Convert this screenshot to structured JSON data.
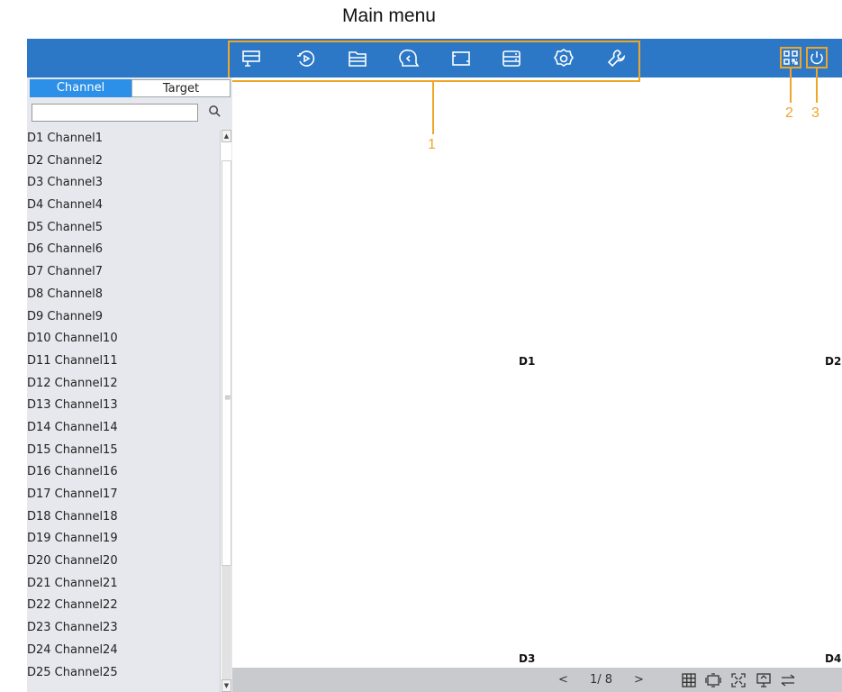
{
  "annotation": {
    "title": "Main menu",
    "callouts": [
      "1",
      "2",
      "3"
    ]
  },
  "toolbar": {
    "main_menu_icons": [
      "live-view-icon",
      "playback-icon",
      "file-icon",
      "ai-face-icon",
      "channel-camera-icon",
      "storage-icon",
      "settings-icon",
      "maintenance-icon"
    ],
    "right_icons": [
      "qr-code-icon",
      "power-icon"
    ],
    "accent": "#2c78c7",
    "highlight": "#f0a526"
  },
  "sidebar": {
    "tabs": [
      {
        "label": "Channel",
        "active": true
      },
      {
        "label": "Target",
        "active": false
      }
    ],
    "search": {
      "placeholder": "",
      "value": ""
    },
    "channels": [
      "D1 Channel1",
      "D2 Channel2",
      "D3 Channel3",
      "D4 Channel4",
      "D5 Channel5",
      "D6 Channel6",
      "D7 Channel7",
      "D8 Channel8",
      "D9 Channel9",
      "D10 Channel10",
      "D11 Channel11",
      "D12 Channel12",
      "D13 Channel13",
      "D14 Channel14",
      "D15 Channel15",
      "D16 Channel16",
      "D17 Channel17",
      "D18 Channel18",
      "D19 Channel19",
      "D20 Channel20",
      "D21 Channel21",
      "D22 Channel22",
      "D23 Channel23",
      "D24 Channel24",
      "D25 Channel25"
    ]
  },
  "video_grid": {
    "labels": [
      "D1",
      "D2",
      "D3",
      "D4"
    ]
  },
  "bottombar": {
    "prev": "<",
    "page": "1/ 8",
    "next": ">",
    "icons": [
      "layout-grid-icon",
      "sequence-icon",
      "fullscreen-icon",
      "output-icon",
      "switch-icon"
    ]
  }
}
